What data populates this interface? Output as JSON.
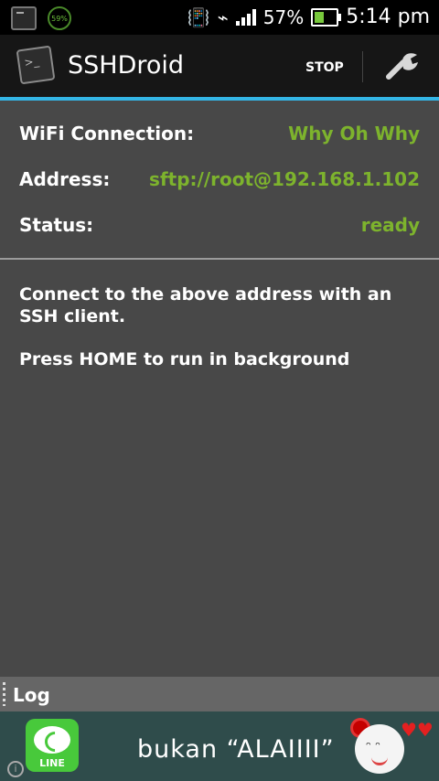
{
  "status_bar": {
    "notification_battery": "59%",
    "battery_percent": "57%",
    "time": "5:14 pm",
    "icons": [
      "terminal-notification-icon",
      "battery-circle-icon",
      "vibrate-icon",
      "wifi-icon",
      "signal-icon",
      "battery-icon"
    ]
  },
  "action_bar": {
    "app_title": "SSHDroid",
    "stop_label": "STOP",
    "icons": [
      "app-terminal-icon",
      "wrench-icon"
    ],
    "accent_color": "#33b5e5"
  },
  "details": {
    "rows": [
      {
        "label": "WiFi Connection:",
        "value": "Why Oh Why"
      },
      {
        "label": "Address:",
        "value": "sftp://root@192.168.1.102"
      },
      {
        "label": "Status:",
        "value": "ready"
      }
    ],
    "value_color": "#7db32d"
  },
  "instructions": {
    "line1": "Connect to the above address with an SSH client.",
    "line2": "Press HOME to run in background"
  },
  "log": {
    "label": "Log"
  },
  "ad": {
    "brand": "LINE",
    "text": "bukan “ALAIIII”",
    "icons": [
      "line-logo-icon",
      "sticker-face-icon",
      "info-icon"
    ]
  }
}
